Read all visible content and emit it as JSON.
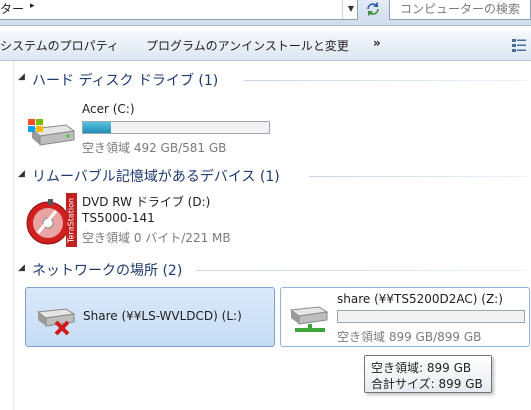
{
  "address_bar": {
    "path_fragment": "ター",
    "breadcrumb_arrow": "▸",
    "dropdown_icon": "chevron-down-icon",
    "refresh_icon": "refresh-icon",
    "search_placeholder": "コンピューターの検索"
  },
  "toolbar": {
    "system_properties": "システムのプロパティ",
    "uninstall": "プログラムのアンインストールと変更",
    "more": "»",
    "view_icon": "view-options-icon"
  },
  "groups": [
    {
      "title": "ハード ディスク ドライブ (1)",
      "items": [
        {
          "name": "Acer (C:)",
          "free_text": "空き領域 492 GB/581 GB",
          "used_fraction": 0.153,
          "icon": "windows-hard-drive-icon"
        }
      ]
    },
    {
      "title": "リムーバブル記憶域があるデバイス (1)",
      "items": [
        {
          "name": "DVD RW ドライブ (D:)",
          "label": "TS5000-141",
          "free_text": "空き領域 0 バイト/221 MB",
          "icon": "terastation-disc-icon",
          "disc_text": "TeraStation"
        }
      ]
    },
    {
      "title": "ネットワークの場所 (2)",
      "items": [
        {
          "name": "Share (¥¥LS-WVLDCD) (L:)",
          "icon": "disconnected-network-drive-icon",
          "selected": true
        },
        {
          "name": "share (¥¥TS5200D2AC) (Z:)",
          "free_text": "空き領域 899 GB/899 GB",
          "used_fraction": 0.0,
          "icon": "network-drive-icon"
        }
      ]
    }
  ],
  "tooltip": {
    "free": "空き領域: 899 GB",
    "total": "合計サイズ: 899 GB"
  },
  "colors": {
    "group_title": "#1e3a6e",
    "bar_fill": "#26a0c8",
    "selection": "#cfe2f8"
  }
}
